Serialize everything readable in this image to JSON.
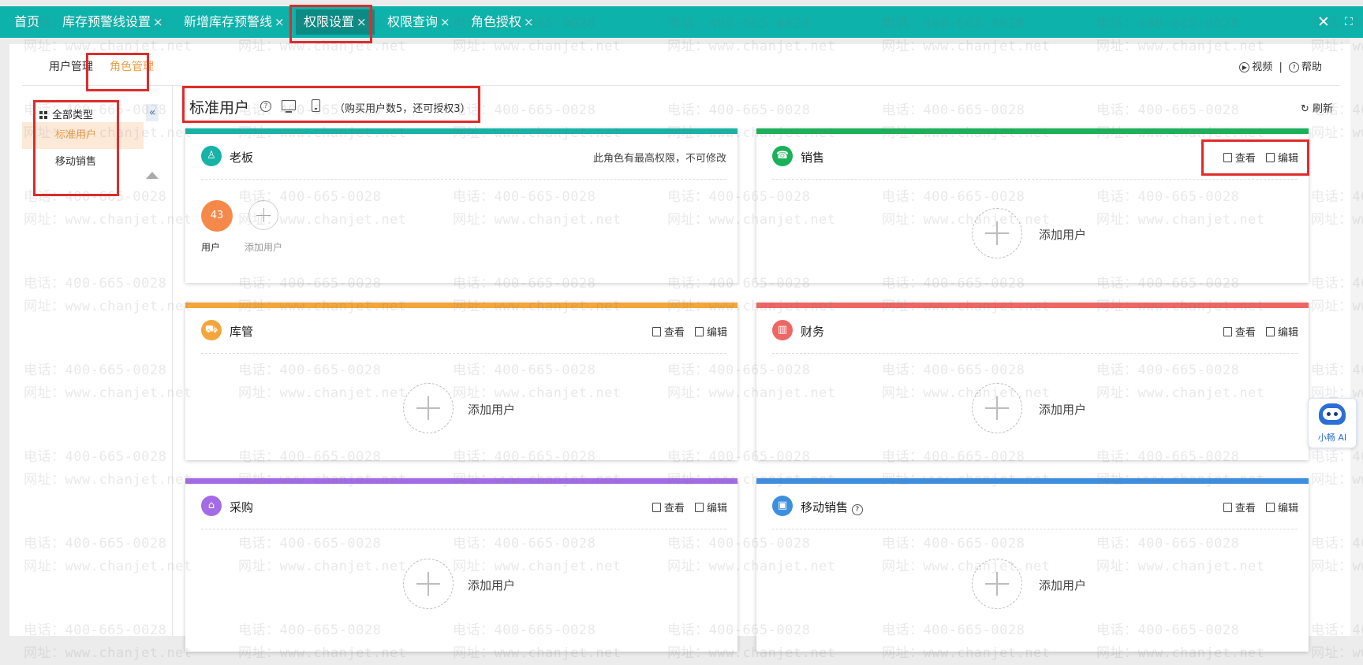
{
  "top_tabs": [
    {
      "label": "首页",
      "closable": false
    },
    {
      "label": "库存预警线设置",
      "closable": true
    },
    {
      "label": "新增库存预警线",
      "closable": true
    },
    {
      "label": "权限设置",
      "closable": true,
      "active": true
    },
    {
      "label": "权限查询",
      "closable": true
    },
    {
      "label": "角色授权",
      "closable": true
    }
  ],
  "close_glyph": "×",
  "window_controls": {
    "close_icon": "close-icon",
    "fullscreen_icon": "fullscreen-icon"
  },
  "sub_tabs": {
    "user_mgmt": "用户管理",
    "role_mgmt": "角色管理"
  },
  "help": {
    "video": "视频",
    "separator": "|",
    "help": "帮助"
  },
  "tree": {
    "all_label": "全部类型",
    "items": [
      "标准用户",
      "移动销售"
    ]
  },
  "header": {
    "title": "标准用户",
    "quota": "（购买用户数5，还可授权3）",
    "refresh": "刷新"
  },
  "cards": [
    {
      "name": "老板",
      "color": "#17b3a6",
      "icon": "person-icon",
      "note": "此角色有最高权限，不可修改",
      "user_count": "43",
      "user_label": "用户",
      "add_label": "添加用户"
    },
    {
      "name": "销售",
      "color": "#1ab159",
      "icon": "sales-icon",
      "view": "查看",
      "edit": "编辑",
      "add_label": "添加用户"
    },
    {
      "name": "库管",
      "color": "#f4a63b",
      "icon": "cart-icon",
      "view": "查看",
      "edit": "编辑",
      "add_label": "添加用户"
    },
    {
      "name": "财务",
      "color": "#ef6665",
      "icon": "chart-icon",
      "view": "查看",
      "edit": "编辑",
      "add_label": "添加用户"
    },
    {
      "name": "采购",
      "color": "#a46be6",
      "icon": "warehouse-icon",
      "view": "查看",
      "edit": "编辑",
      "add_label": "添加用户"
    },
    {
      "name": "移动销售",
      "color": "#3e8ee0",
      "icon": "mobile-sales-icon",
      "view": "查看",
      "edit": "编辑",
      "add_label": "添加用户"
    }
  ],
  "ai_assistant": {
    "label": "小畅 AI"
  },
  "watermark": {
    "line1": "电话：400-665-0028",
    "line2": "网址：www.chanjet.net"
  }
}
